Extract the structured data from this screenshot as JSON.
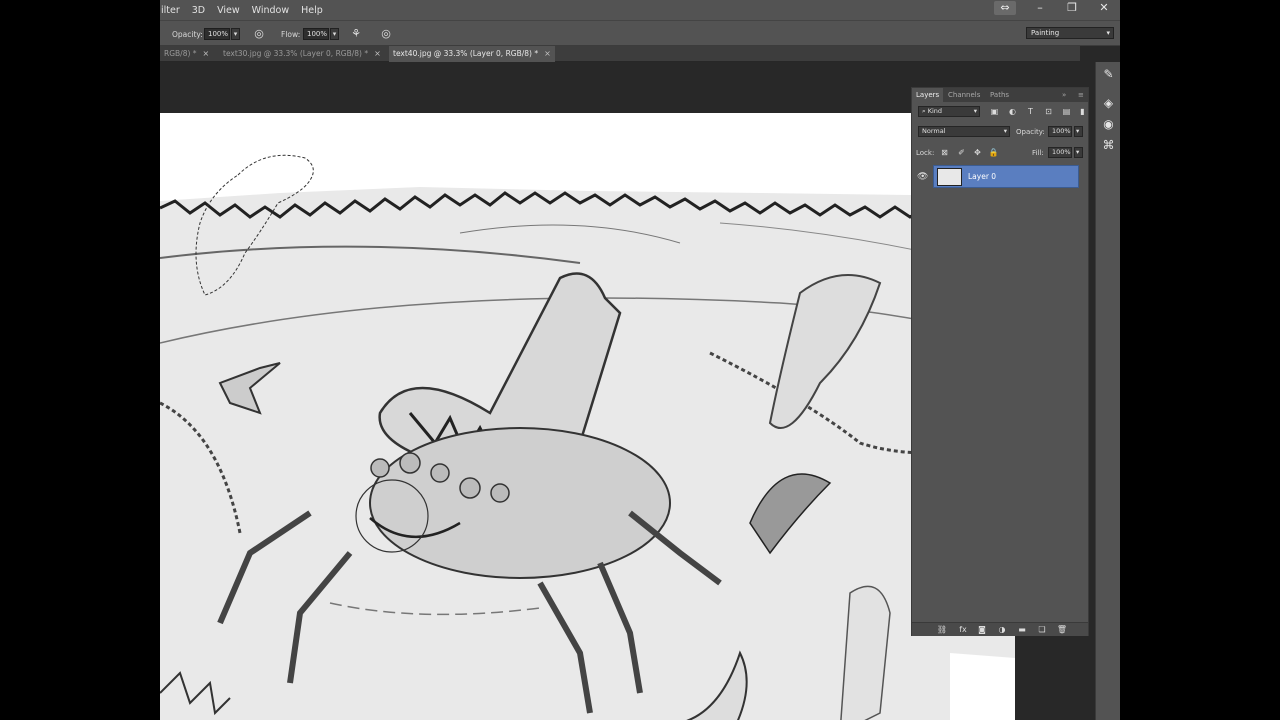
{
  "menu": {
    "items": [
      "ilter",
      "3D",
      "View",
      "Window",
      "Help"
    ]
  },
  "options": {
    "opacity_label": "Opacity:",
    "opacity_value": "100%",
    "flow_label": "Flow:",
    "flow_value": "100%",
    "workspace": "Painting"
  },
  "tabs": [
    {
      "label": "RGB/8) *",
      "close": "×",
      "active": false
    },
    {
      "label": "text30.jpg @ 33.3% (Layer 0, RGB/8) *",
      "close": "×",
      "active": false
    },
    {
      "label": "text40.jpg @ 33.3% (Layer 0, RGB/8) *",
      "close": "×",
      "active": true
    }
  ],
  "layers_panel": {
    "tabs": [
      "Layers",
      "Channels",
      "Paths"
    ],
    "filter_kind": "Kind",
    "blend_mode": "Normal",
    "opacity_label": "Opacity:",
    "opacity_value": "100%",
    "lock_label": "Lock:",
    "fill_label": "Fill:",
    "fill_value": "100%",
    "layer_name": "Layer 0"
  },
  "icons": {
    "brush_pressure": "airbrush-icon",
    "tablet_pressure": "pressure-icon",
    "close": "close-icon",
    "minimize": "minimize-icon",
    "restore": "restore-icon",
    "arrange": "arrange-icon"
  },
  "colors": {
    "chrome": "#535353",
    "canvas_bg": "#282828",
    "layer_selected": "#5a7ec0"
  }
}
